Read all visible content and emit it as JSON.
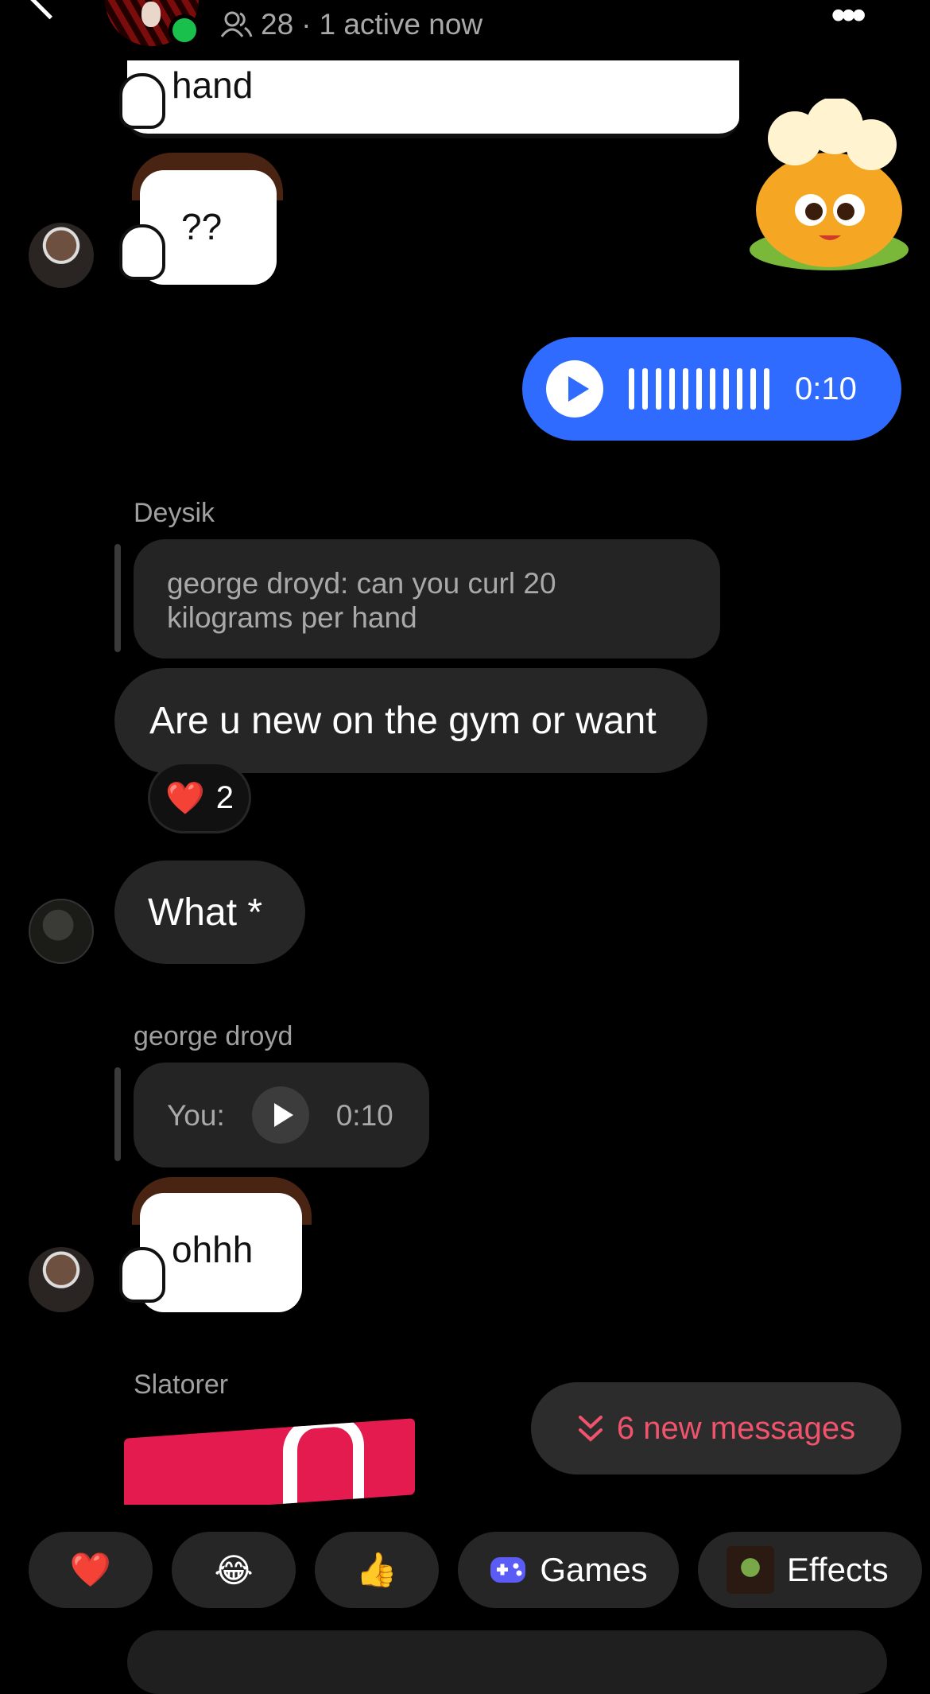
{
  "header": {
    "member_count": "28",
    "separator": "·",
    "active_status": "1 active now"
  },
  "messages": {
    "sticker_hand_text": "hand",
    "sticker_question_text": "??",
    "voice_duration": "0:10",
    "deysik": {
      "name": "Deysik",
      "quote": "george droyd: can you curl 20 kilograms per hand",
      "text": "Are u new on the gym or want",
      "reaction_emoji": "❤️",
      "reaction_count": "2"
    },
    "what_text": "What *",
    "george": {
      "name": "george droyd",
      "quote_prefix": "You:",
      "quote_duration": "0:10"
    },
    "sticker_ohhh_text": "ohhh",
    "slatorer_name": "Slatorer"
  },
  "new_messages": {
    "label": "6 new messages"
  },
  "quick_bar": {
    "heart": "❤️",
    "laugh": "😂",
    "thumbs": "👍",
    "games": "Games",
    "effects": "Effects"
  },
  "colors": {
    "accent_blue": "#2f6bff",
    "online_green": "#19c14c",
    "new_messages_pink": "#f2536c"
  }
}
